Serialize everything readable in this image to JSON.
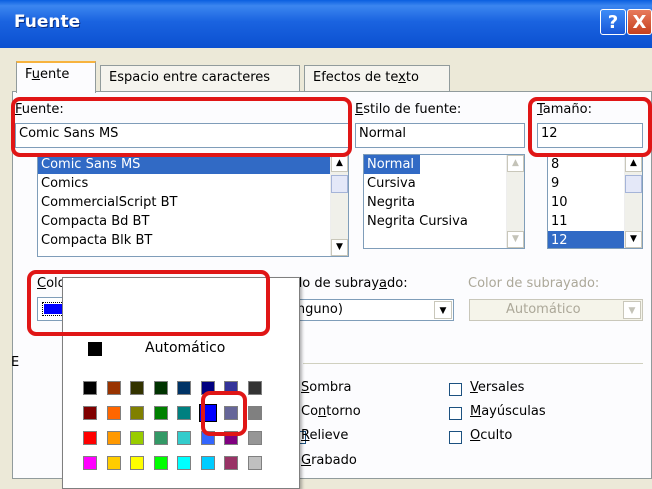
{
  "window": {
    "title": "Fuente",
    "help_label": "?",
    "close_label": "X"
  },
  "tabs": [
    {
      "label": "Fuente",
      "active": true
    },
    {
      "label": "Espacio entre caracteres",
      "active": false
    },
    {
      "label": "Efectos de texto",
      "active": false
    }
  ],
  "font": {
    "label": "Fuente:",
    "value": "Comic Sans MS",
    "items": [
      "Comic Sans MS",
      "Comics",
      "CommercialScript BT",
      "Compacta Bd BT",
      "Compacta Blk BT"
    ],
    "selected": "Comic Sans MS"
  },
  "style": {
    "label": "Estilo de fuente:",
    "value": "Normal",
    "items": [
      "Normal",
      "Cursiva",
      "Negrita",
      "Negrita Cursiva"
    ],
    "selected": "Normal"
  },
  "size": {
    "label": "Tamaño:",
    "value": "12",
    "items": [
      "8",
      "9",
      "10",
      "11",
      "12"
    ],
    "selected": "12"
  },
  "font_color": {
    "label": "Color de fuente:",
    "value_color": "#0000ff"
  },
  "underline_style": {
    "label": "Estilo de subrayado:",
    "value": "(ninguno)"
  },
  "underline_color": {
    "label": "Color de subrayado:",
    "value": "Automático"
  },
  "effects_label_fragment": "E",
  "effects": [
    {
      "label": "Sombra",
      "checkbox": false
    },
    {
      "label": "Contorno",
      "checkbox": false
    },
    {
      "label": "Relieve",
      "checkbox": true
    },
    {
      "label": "Grabado",
      "checkbox": false
    },
    {
      "label": "Versales",
      "checkbox": true
    },
    {
      "label": "Mayúsculas",
      "checkbox": true
    },
    {
      "label": "Oculto",
      "checkbox": true
    }
  ],
  "color_popup": {
    "auto_label": "Automático",
    "auto_color": "#000000",
    "selected_color": "#0000ff",
    "rows": [
      [
        "#000000",
        "#993300",
        "#333300",
        "#003300",
        "#003366",
        "#000080",
        "#333399",
        "#333333"
      ],
      [
        "#800000",
        "#ff6600",
        "#808000",
        "#008000",
        "#008080",
        "#0000ff",
        "#666699",
        "#808080"
      ],
      [
        "#ff0000",
        "#ff9900",
        "#99cc00",
        "#339966",
        "#33cccc",
        "#3366ff",
        "#800080",
        "#969696"
      ],
      [
        "#ff00ff",
        "#ffcc00",
        "#ffff00",
        "#00ff00",
        "#00ffff",
        "#00ccff",
        "#993366",
        "#c0c0c0"
      ]
    ]
  },
  "colors": {
    "highlight": "#e01616",
    "selection": "#316ac5",
    "title_bar": "#0b50d0"
  }
}
